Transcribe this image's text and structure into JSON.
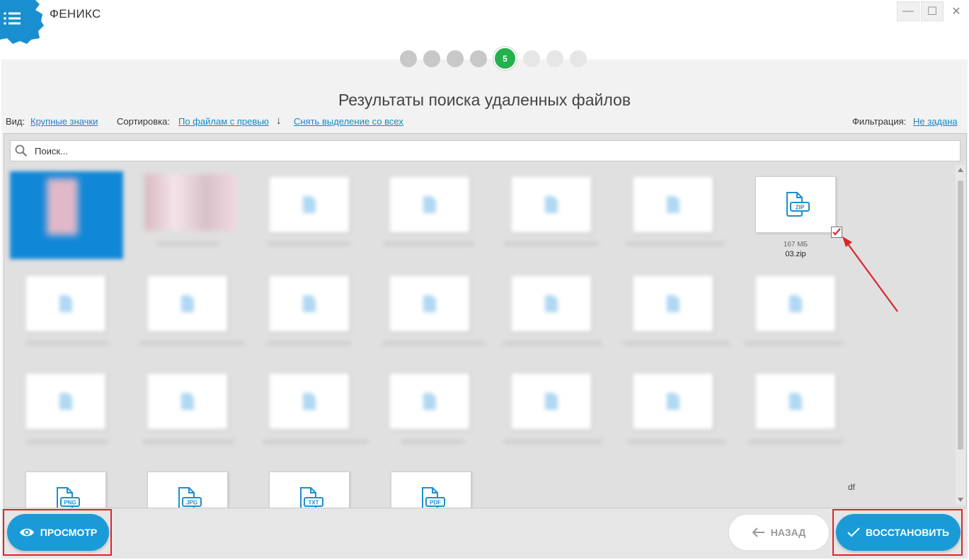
{
  "app": {
    "title": "ФЕНИКС"
  },
  "window_controls": {
    "minimize": "—",
    "maximize": "☐",
    "close": "✕"
  },
  "steps": {
    "active_label": "5",
    "total": 8,
    "active_index": 5
  },
  "page_title": "Результаты поиска удаленных файлов",
  "toolbar": {
    "view_label": "Вид:",
    "view_value": "Крупные значки",
    "sort_label": "Сортировка:",
    "sort_value": "По файлам с превью",
    "sort_direction_glyph": "↓",
    "deselect_all": "Снять выделение со всех",
    "filter_label": "Фильтрация:",
    "filter_value": "Не задана"
  },
  "search": {
    "placeholder": "Поиск..."
  },
  "files": {
    "selected_tile": {
      "size": "167 МБ",
      "name": "03.zip",
      "type_badge": "ZIP",
      "checked": true
    },
    "bottom_row_badges": [
      "PNG",
      "JPG",
      "TXT",
      "PDF"
    ],
    "stray_fragment": "df"
  },
  "buttons": {
    "preview": "ПРОСМОТР",
    "back": "НАЗАД",
    "restore": "ВОССТАНОВИТЬ"
  },
  "colors": {
    "accent": "#1a9bd7",
    "step_active": "#22b14c",
    "link": "#1a86c8",
    "annotation": "#d9262c"
  }
}
